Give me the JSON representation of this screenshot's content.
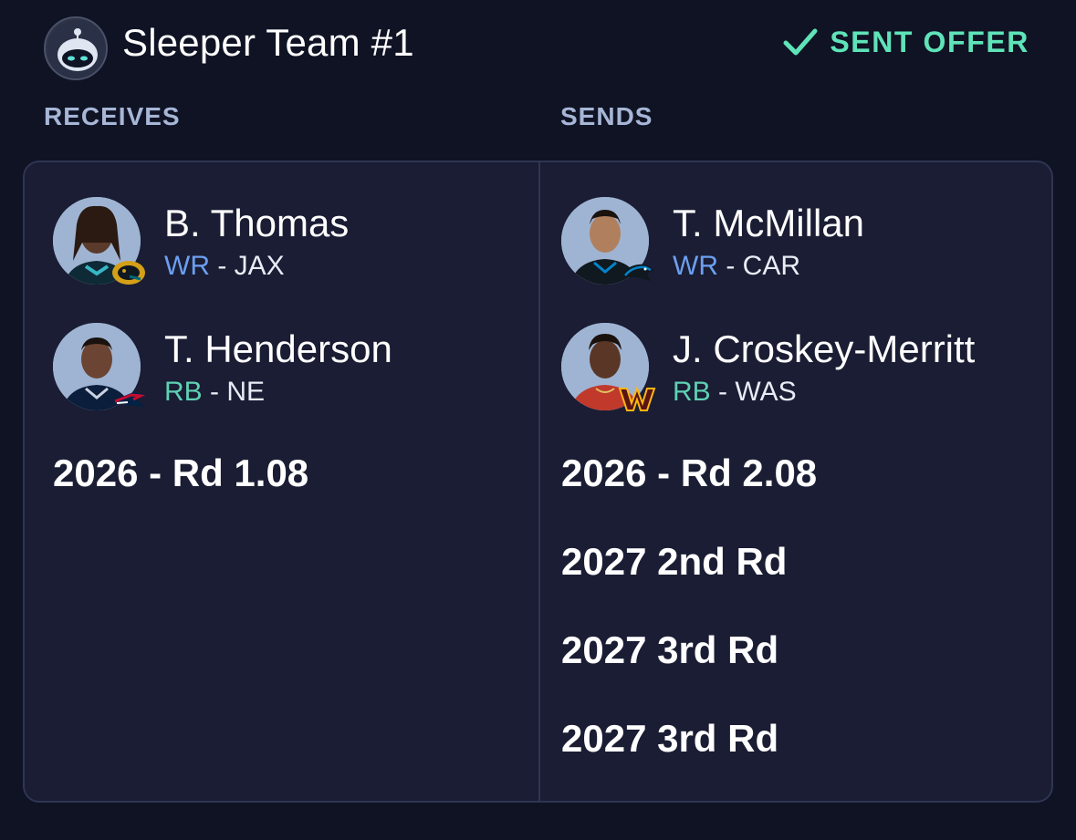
{
  "header": {
    "team_name": "Sleeper Team #1",
    "status": "SENT OFFER",
    "status_color": "#5fe3b8"
  },
  "receives": {
    "label": "RECEIVES",
    "players": [
      {
        "name": "B. Thomas",
        "position": "WR",
        "team": "JAX",
        "team_icon": "jaguars-logo-icon"
      },
      {
        "name": "T. Henderson",
        "position": "RB",
        "team": "NE",
        "team_icon": "patriots-logo-icon"
      }
    ],
    "picks": [
      "2026 - Rd 1.08"
    ]
  },
  "sends": {
    "label": "SENDS",
    "players": [
      {
        "name": "T. McMillan",
        "position": "WR",
        "team": "CAR",
        "team_icon": "panthers-logo-icon"
      },
      {
        "name": "J. Croskey-Merritt",
        "position": "RB",
        "team": "WAS",
        "team_icon": "commanders-logo-icon"
      }
    ],
    "picks": [
      "2026 - Rd 2.08",
      "2027 2nd Rd",
      "2027 3rd Rd",
      "2027 3rd Rd"
    ]
  },
  "separator": "-",
  "colors": {
    "background": "#0f1324",
    "card": "#1a1d33",
    "wr": "#6c9ff0",
    "rb": "#5fd0b4",
    "section_label": "#a7b6d6"
  }
}
